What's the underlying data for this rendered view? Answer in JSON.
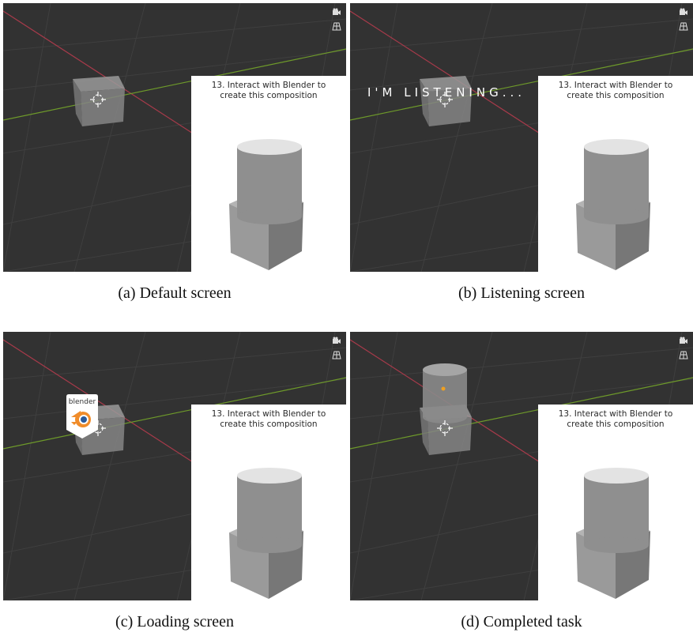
{
  "panels": [
    {
      "caption": "(a) Default screen",
      "card_title": "13. Interact with Blender to\ncreate this composition"
    },
    {
      "caption": "(b) Listening screen",
      "card_title": "13. Interact with Blender to\ncreate this composition",
      "overlay_text": "I'M LISTENING..."
    },
    {
      "caption": "(c) Loading screen",
      "card_title": "13. Interact with Blender to\ncreate this composition",
      "logo_text": "blender"
    },
    {
      "caption": "(d) Completed task",
      "card_title": "13. Interact with Blender to\ncreate this composition"
    }
  ],
  "icons": [
    "camera-icon",
    "grid-icon",
    "3d-cursor-icon",
    "blender-logo-icon"
  ],
  "colors": {
    "viewport_bg": "#323232",
    "x_axis": "#a63a4a",
    "y_axis": "#6e9a2a",
    "grid_line": "#3d3d3d",
    "object_gray": "#8c8c8c"
  }
}
